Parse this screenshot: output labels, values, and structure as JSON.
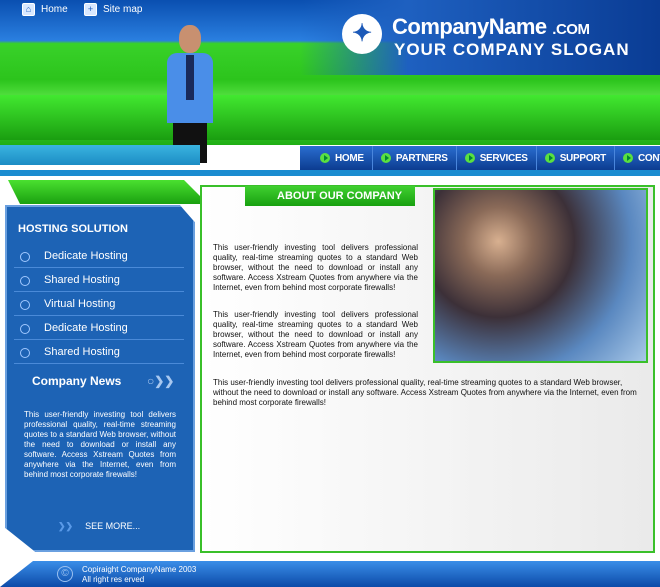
{
  "header": {
    "company_name": "CompanyName",
    "company_tld": ".COM",
    "slogan": "YOUR COMPANY SLOGAN"
  },
  "subnav": [
    {
      "label": "Home",
      "icon": "home-icon"
    },
    {
      "label": "Site map",
      "icon": "sitemap-icon"
    }
  ],
  "menu": [
    "HOME",
    "PARTNERS",
    "SERVICES",
    "SUPPORT",
    "CONTACTS"
  ],
  "sidebar": {
    "title": "HOSTING SOLUTION",
    "items": [
      "Dedicate Hosting",
      "Shared Hosting",
      "Virtual Hosting",
      "Dedicate Hosting",
      "Shared Hosting"
    ],
    "news_title": "Company News",
    "news_text": "This user-friendly investing tool delivers professional quality, real-time streaming quotes to a standard Web browser, without the need to download or install any software. Access Xstream Quotes from anywhere via the Internet, even from behind most corporate firewalls!",
    "see_more": "SEE MORE..."
  },
  "main": {
    "title": "ABOUT OUR COMPANY",
    "paragraphs": [
      "This user-friendly investing tool delivers professional quality, real-time streaming quotes to a standard Web browser, without the need to download or install any software. Access Xstream Quotes from anywhere via the Internet, even from behind most corporate firewalls!",
      "This user-friendly investing tool delivers professional quality, real-time streaming quotes to a standard Web browser, without the need to download or install any software. Access Xstream Quotes from anywhere via the Internet, even from behind most corporate firewalls!",
      "This user-friendly investing tool delivers professional quality, real-time streaming quotes to a standard Web browser, without the need to download or install any software. Access Xstream Quotes from anywhere via the Internet, even from behind most corporate firewalls!"
    ]
  },
  "footer": {
    "copyright": "Copiraight CompanyName 2003",
    "rights": "All right res erved"
  },
  "colors": {
    "green": "#3ac02a",
    "blue": "#1d63b5"
  }
}
